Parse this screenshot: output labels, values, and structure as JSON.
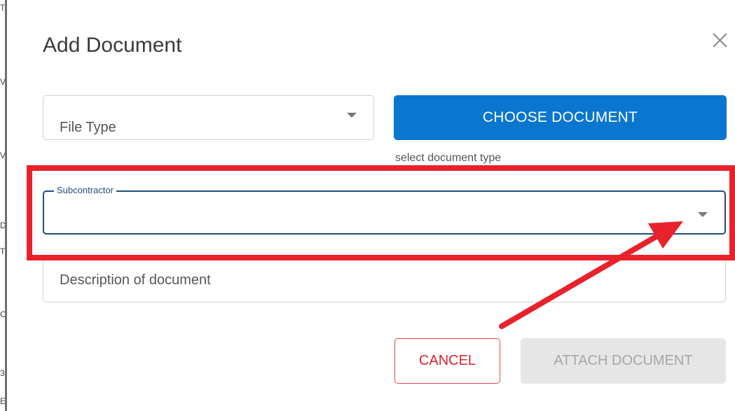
{
  "modal": {
    "title": "Add Document",
    "close_icon": "close-icon"
  },
  "file_type": {
    "placeholder": "File Type",
    "icon": "chevron-down-icon"
  },
  "choose_document": {
    "label": "CHOOSE DOCUMENT",
    "color": "#0a76cf",
    "helper": "select document type"
  },
  "subcontractor": {
    "label": "Subcontractor",
    "value": "",
    "icon": "chevron-down-icon",
    "border_color": "#1f4f7a"
  },
  "description": {
    "placeholder": "Description of document",
    "value": ""
  },
  "actions": {
    "cancel_label": "CANCEL",
    "attach_label": "ATTACH DOCUMENT",
    "attach_disabled": true
  },
  "annotation": {
    "color": "#e8212b",
    "type": "highlight-box-with-arrow"
  }
}
